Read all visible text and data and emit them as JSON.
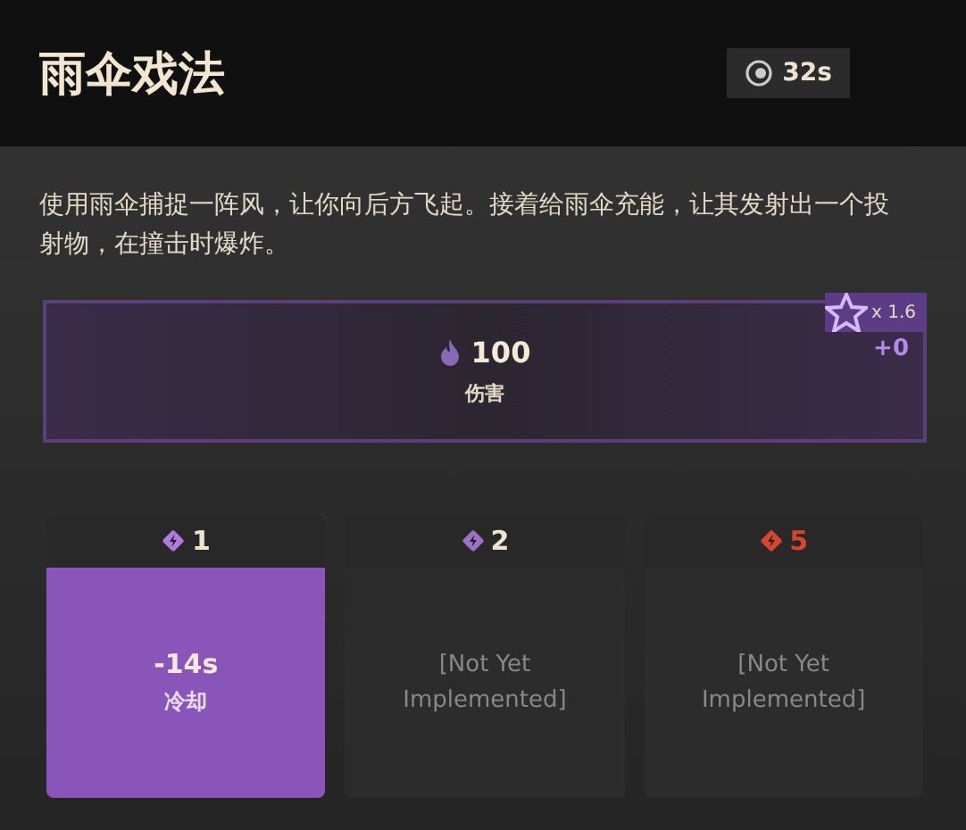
{
  "title": "雨伞戏法",
  "cooldown": "32s",
  "description": "使用雨伞捕捉一阵风，让你向后方飞起。接着给雨伞充能，让其发射出一个投射物，在撞击时爆炸。",
  "damage": {
    "value": "100",
    "label": "伤害",
    "multiplier": "x 1.6",
    "bonus": "+0"
  },
  "upgrades": [
    {
      "cost": "1",
      "color": "#b07ae0",
      "warning": false,
      "selected": true,
      "kind": "effect",
      "value": "-14s",
      "label": "冷却"
    },
    {
      "cost": "2",
      "color": "#9a72c8",
      "warning": false,
      "selected": false,
      "kind": "placeholder",
      "text": "[Not Yet Implemented]"
    },
    {
      "cost": "5",
      "color": "#d8452e",
      "warning": true,
      "selected": false,
      "kind": "placeholder",
      "text": "[Not Yet Implemented]"
    }
  ]
}
